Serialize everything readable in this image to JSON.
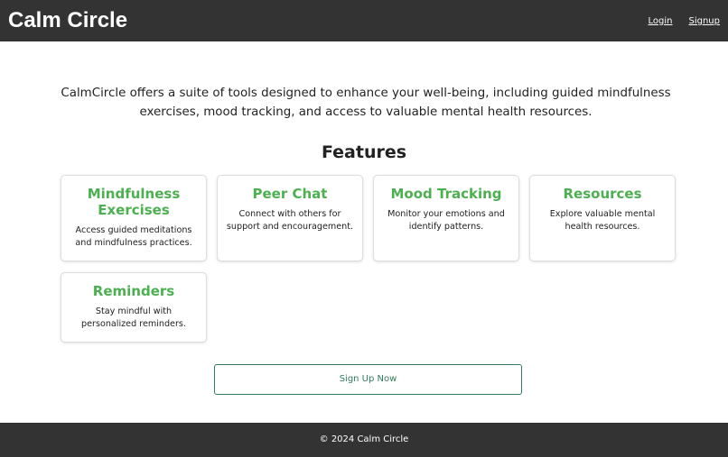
{
  "header": {
    "brand": "Calm Circle",
    "nav": [
      {
        "label": "Login"
      },
      {
        "label": "Signup"
      }
    ]
  },
  "main": {
    "intro": "CalmCircle offers a suite of tools designed to enhance your well-being, including guided mindfulness exercises, mood tracking, and access to valuable mental health resources.",
    "features_title": "Features",
    "features": [
      {
        "title": "Mindfulness Exercises",
        "description": "Access guided meditations and mindfulness practices."
      },
      {
        "title": "Peer Chat",
        "description": "Connect with others for support and encouragement."
      },
      {
        "title": "Mood Tracking",
        "description": "Monitor your emotions and identify patterns."
      },
      {
        "title": "Resources",
        "description": "Explore valuable mental health resources."
      },
      {
        "title": "Reminders",
        "description": "Stay mindful with personalized reminders."
      }
    ],
    "cta_label": "Sign Up Now"
  },
  "footer": {
    "text": "© 2024 Calm Circle"
  },
  "colors": {
    "header_bg": "#333333",
    "accent_green": "#4caf50",
    "button_border": "#2e7d5b"
  }
}
